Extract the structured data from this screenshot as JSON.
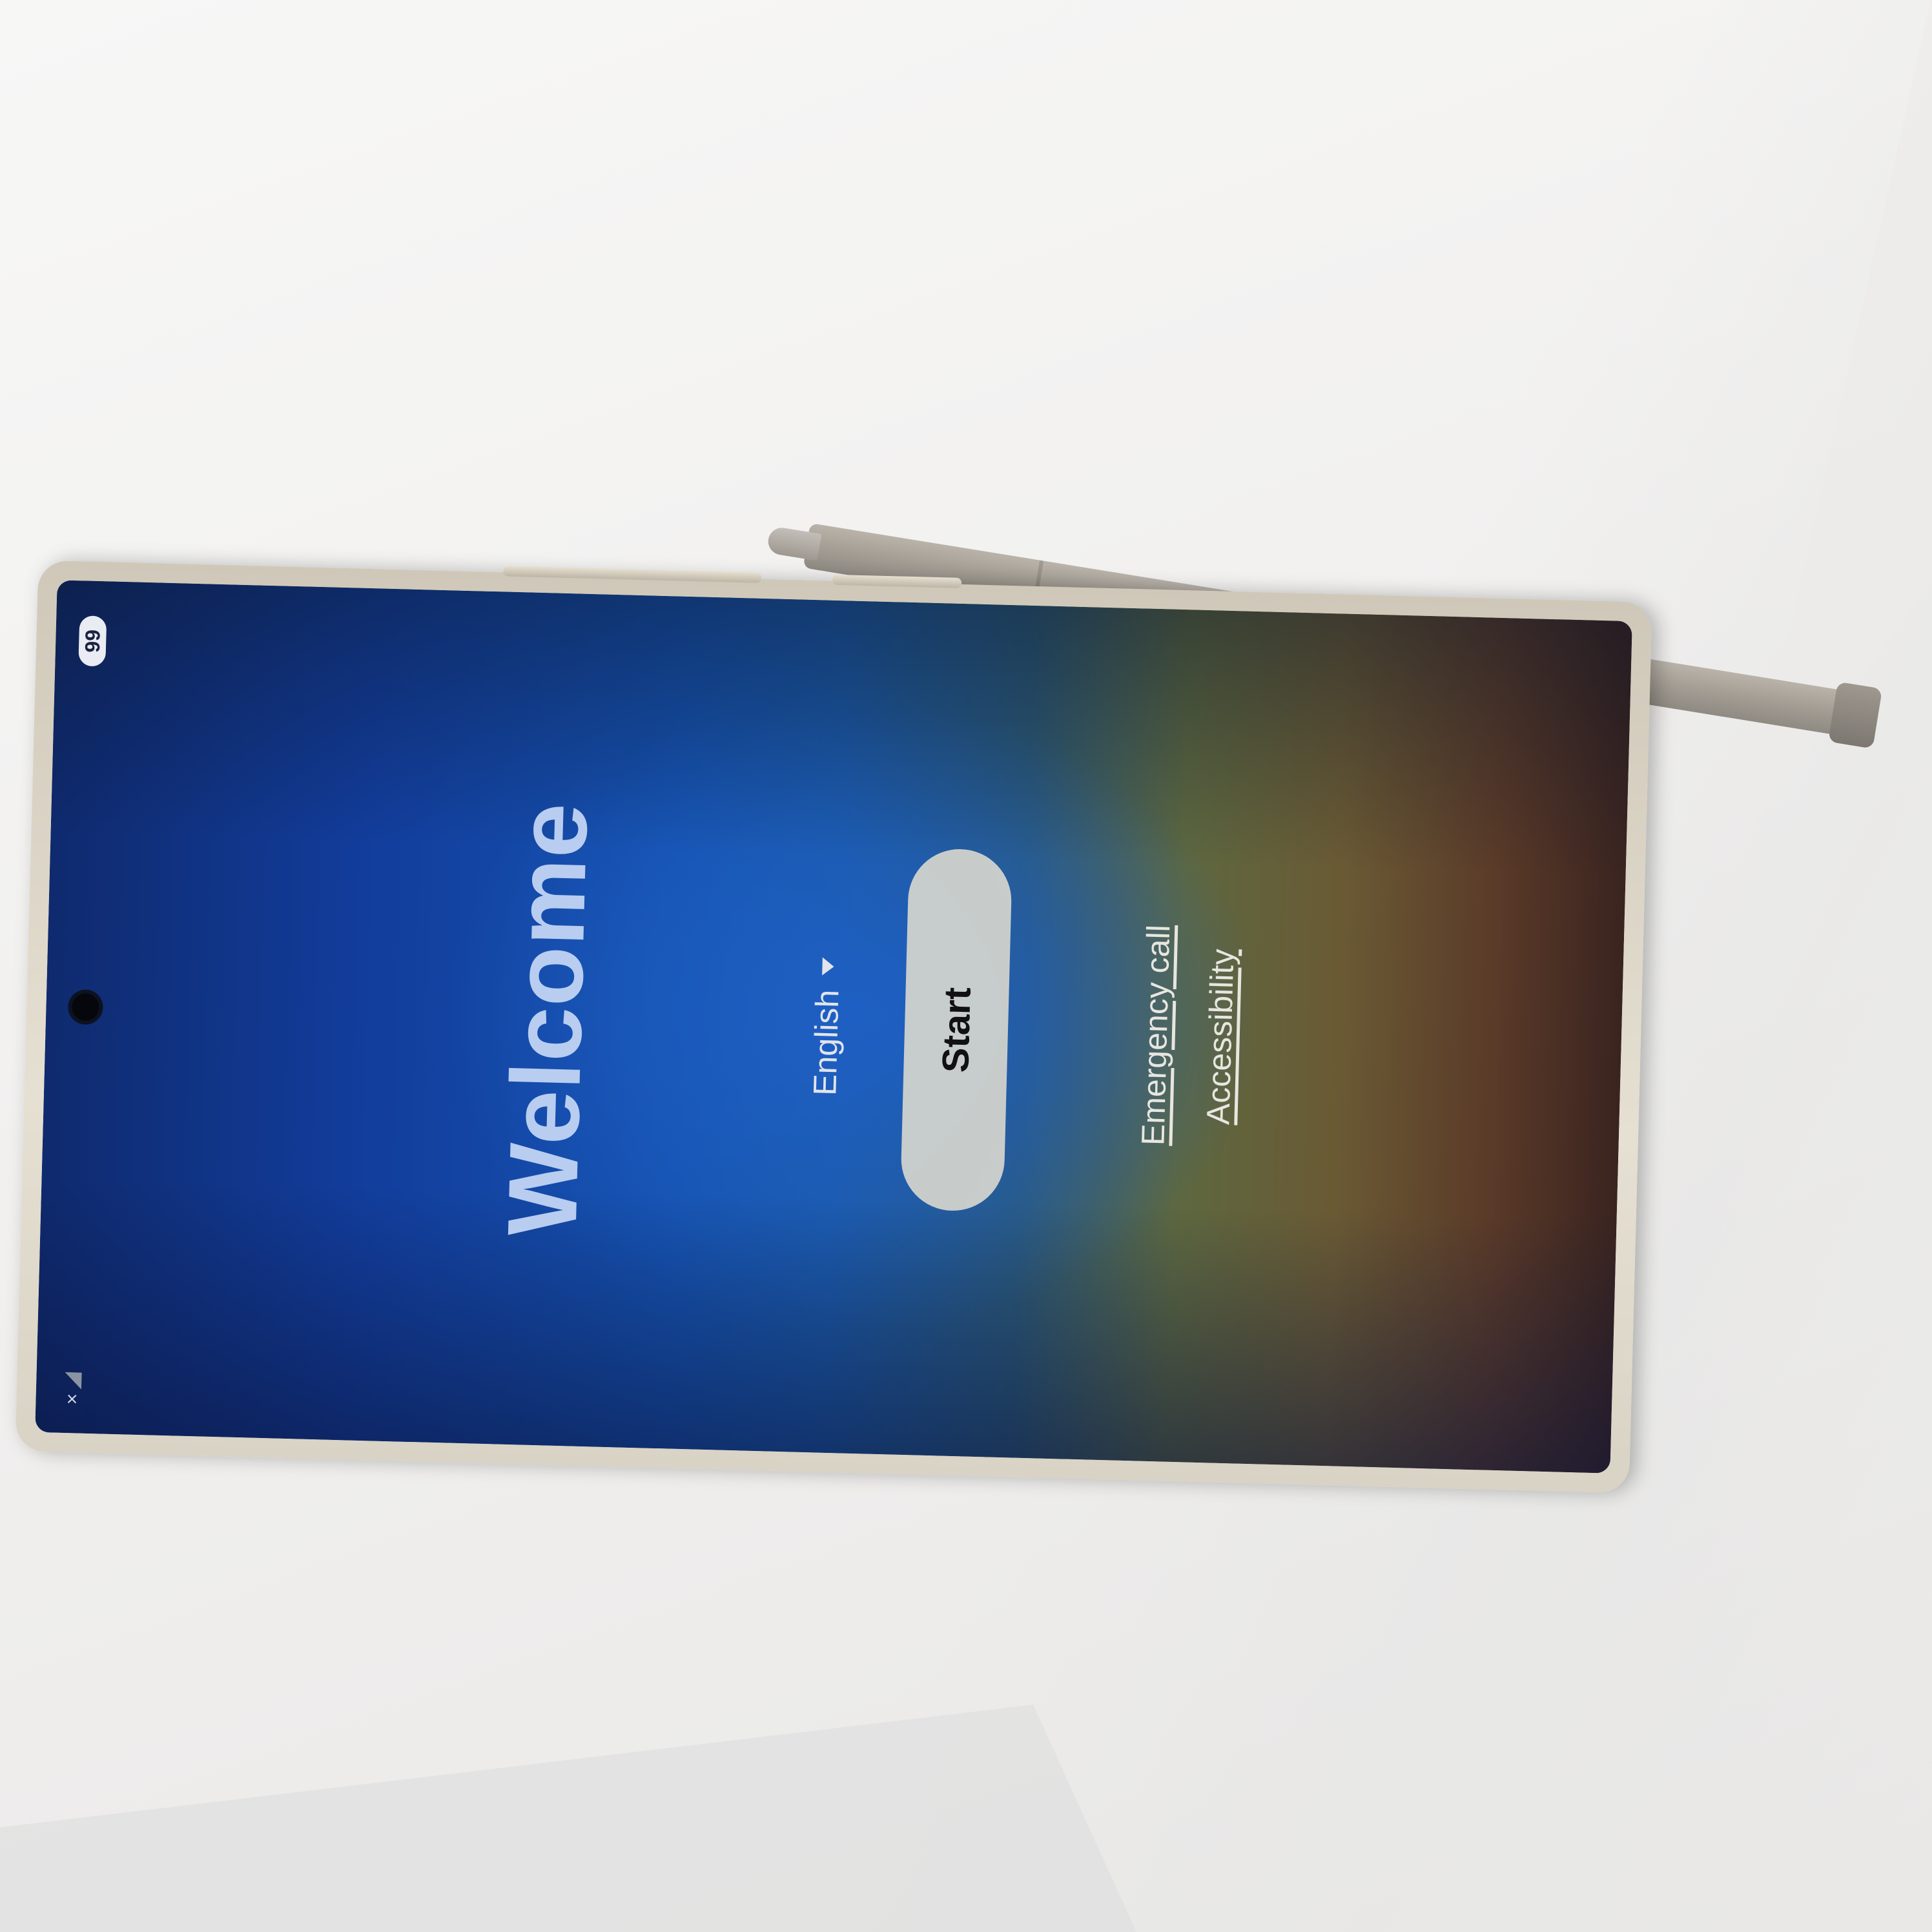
{
  "status_bar": {
    "notification_count": "99",
    "signal_icon": "no-signal-icon"
  },
  "setup_screen": {
    "title": "Welcome",
    "language": "English",
    "start_label": "Start",
    "emergency_label": "Emergency call",
    "accessibility_label": "Accessibility"
  }
}
